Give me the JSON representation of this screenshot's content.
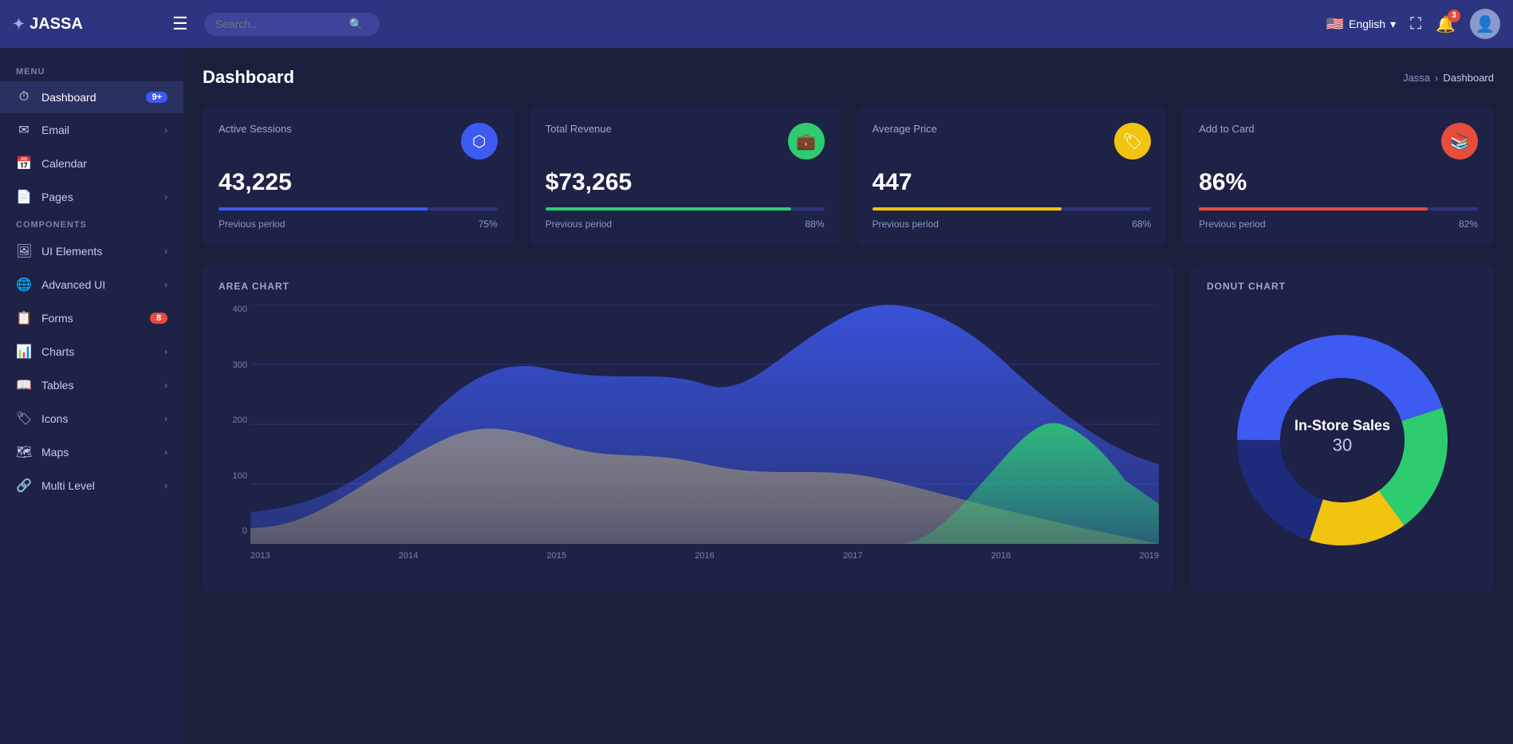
{
  "app": {
    "logo": "JASSA",
    "logo_icon": "✦"
  },
  "topnav": {
    "search_placeholder": "Search...",
    "language": "English",
    "notif_count": "3",
    "fullscreen_title": "Fullscreen"
  },
  "breadcrumb": {
    "parent": "Jassa",
    "current": "Dashboard"
  },
  "page": {
    "title": "Dashboard"
  },
  "sidebar": {
    "menu_label": "MENU",
    "components_label": "COMPONENTS",
    "items": [
      {
        "id": "dashboard",
        "label": "Dashboard",
        "icon": "⏱",
        "badge": "9+",
        "badge_type": "blue",
        "has_chevron": false
      },
      {
        "id": "email",
        "label": "Email",
        "icon": "✉",
        "badge": "",
        "badge_type": "",
        "has_chevron": true
      },
      {
        "id": "calendar",
        "label": "Calendar",
        "icon": "📅",
        "badge": "",
        "badge_type": "",
        "has_chevron": false
      },
      {
        "id": "pages",
        "label": "Pages",
        "icon": "📄",
        "badge": "",
        "badge_type": "",
        "has_chevron": true
      }
    ],
    "component_items": [
      {
        "id": "ui-elements",
        "label": "UI Elements",
        "icon": "🖼",
        "badge": "",
        "badge_type": "",
        "has_chevron": true
      },
      {
        "id": "advanced-ui",
        "label": "Advanced UI",
        "icon": "🌐",
        "badge": "",
        "badge_type": "",
        "has_chevron": true
      },
      {
        "id": "forms",
        "label": "Forms",
        "icon": "📋",
        "badge": "8",
        "badge_type": "red",
        "has_chevron": false
      },
      {
        "id": "charts",
        "label": "Charts",
        "icon": "📊",
        "badge": "",
        "badge_type": "",
        "has_chevron": true
      },
      {
        "id": "tables",
        "label": "Tables",
        "icon": "📖",
        "badge": "",
        "badge_type": "",
        "has_chevron": true
      },
      {
        "id": "icons",
        "label": "Icons",
        "icon": "🏷",
        "badge": "",
        "badge_type": "",
        "has_chevron": true
      },
      {
        "id": "maps",
        "label": "Maps",
        "icon": "🗺",
        "badge": "",
        "badge_type": "",
        "has_chevron": true
      },
      {
        "id": "multi-level",
        "label": "Multi Level",
        "icon": "🔗",
        "badge": "",
        "badge_type": "",
        "has_chevron": true
      }
    ]
  },
  "stat_cards": [
    {
      "id": "active-sessions",
      "title": "Active Sessions",
      "value": "43,225",
      "icon": "⬡",
      "icon_color": "blue",
      "bar_color": "blue",
      "bar_pct": 75,
      "period_label": "Previous period",
      "period_value": "75%"
    },
    {
      "id": "total-revenue",
      "title": "Total Revenue",
      "value": "$73,265",
      "icon": "💼",
      "icon_color": "green",
      "bar_color": "green",
      "bar_pct": 88,
      "period_label": "Previous period",
      "period_value": "88%"
    },
    {
      "id": "average-price",
      "title": "Average Price",
      "value": "447",
      "icon": "🏷",
      "icon_color": "yellow",
      "bar_color": "yellow",
      "bar_pct": 68,
      "period_label": "Previous period",
      "period_value": "68%"
    },
    {
      "id": "add-to-card",
      "title": "Add to Card",
      "value": "86%",
      "icon": "📚",
      "icon_color": "red",
      "bar_color": "red",
      "bar_pct": 82,
      "period_label": "Previous period",
      "period_value": "82%"
    }
  ],
  "area_chart": {
    "title": "AREA CHART",
    "y_labels": [
      "400",
      "300",
      "200",
      "100",
      "0"
    ],
    "x_labels": [
      "2013",
      "2014",
      "2015",
      "2016",
      "2017",
      "2018",
      "2019"
    ]
  },
  "donut_chart": {
    "title": "DONUT CHART",
    "center_label": "In-Store Sales",
    "center_value": "30",
    "segments": [
      {
        "label": "Blue",
        "color": "#3d5af1",
        "value": 45
      },
      {
        "label": "Green",
        "color": "#2ecc71",
        "value": 20
      },
      {
        "label": "Yellow",
        "color": "#f1c40f",
        "value": 15
      },
      {
        "label": "Dark Blue",
        "color": "#1e2a7a",
        "value": 20
      }
    ]
  }
}
